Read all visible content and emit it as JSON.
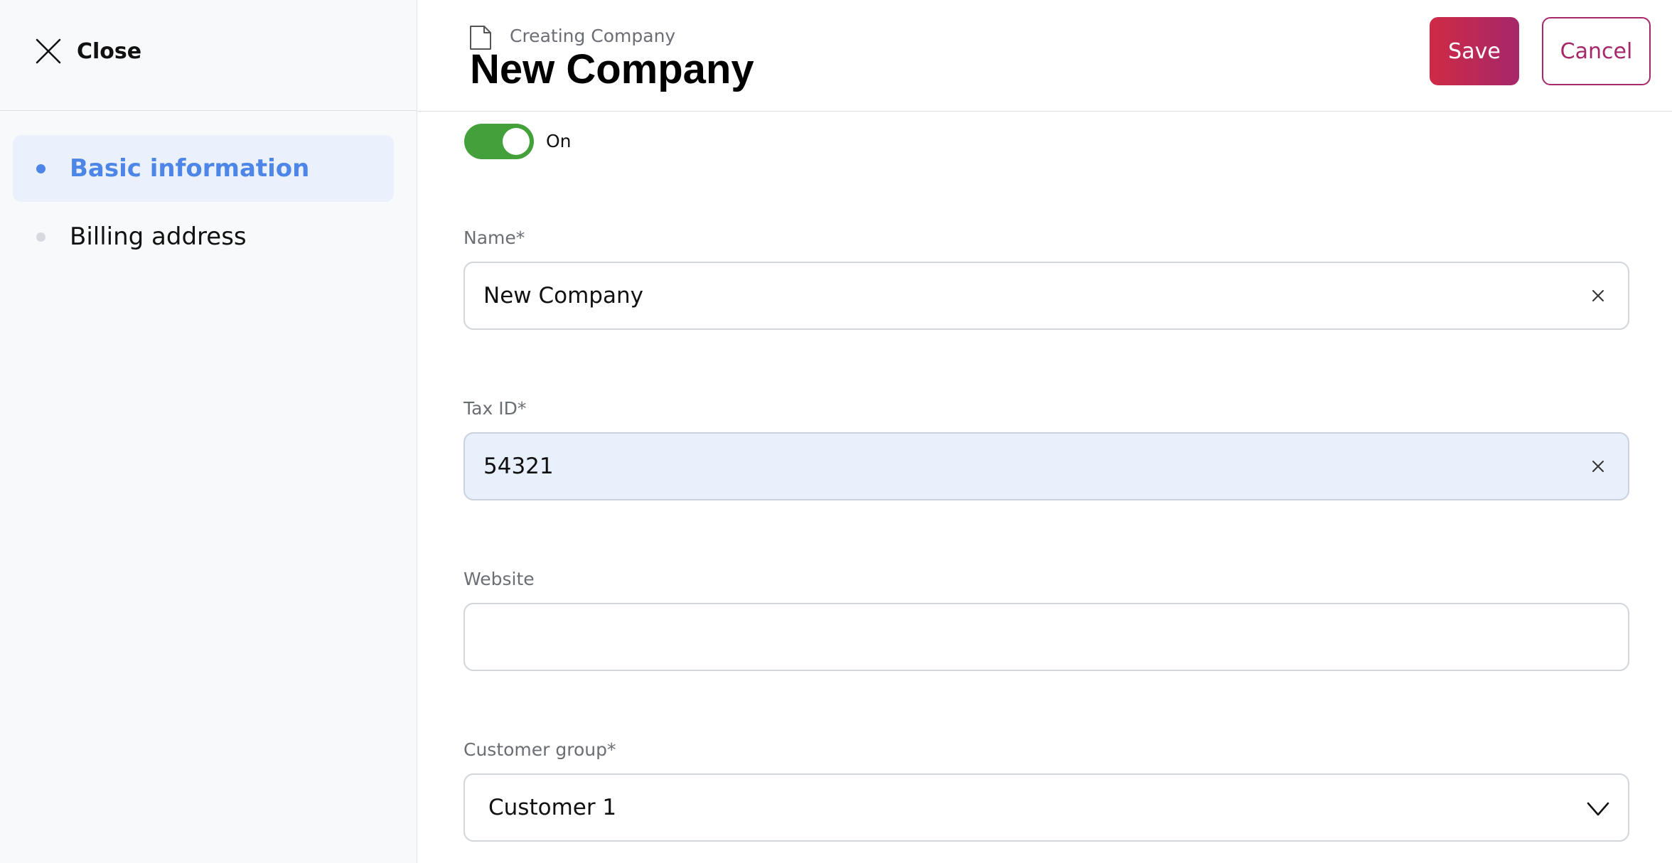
{
  "sidebar": {
    "close_label": "Close",
    "items": [
      {
        "label": "Basic information",
        "active": true
      },
      {
        "label": "Billing address",
        "active": false
      }
    ]
  },
  "header": {
    "subtitle": "Creating Company",
    "title": "New Company",
    "save_label": "Save",
    "cancel_label": "Cancel"
  },
  "form": {
    "toggle": {
      "label": "On",
      "state": true
    },
    "name": {
      "label": "Name*",
      "value": "New Company"
    },
    "tax_id": {
      "label": "Tax ID*",
      "value": "54321"
    },
    "website": {
      "label": "Website",
      "value": ""
    },
    "customer_group": {
      "label": "Customer group*",
      "value": "Customer 1"
    }
  },
  "colors": {
    "accent_blue": "#4d86e6",
    "toggle_green": "#43a03b",
    "brand_red": "#cf2a45",
    "brand_magenta": "#a5286a"
  }
}
